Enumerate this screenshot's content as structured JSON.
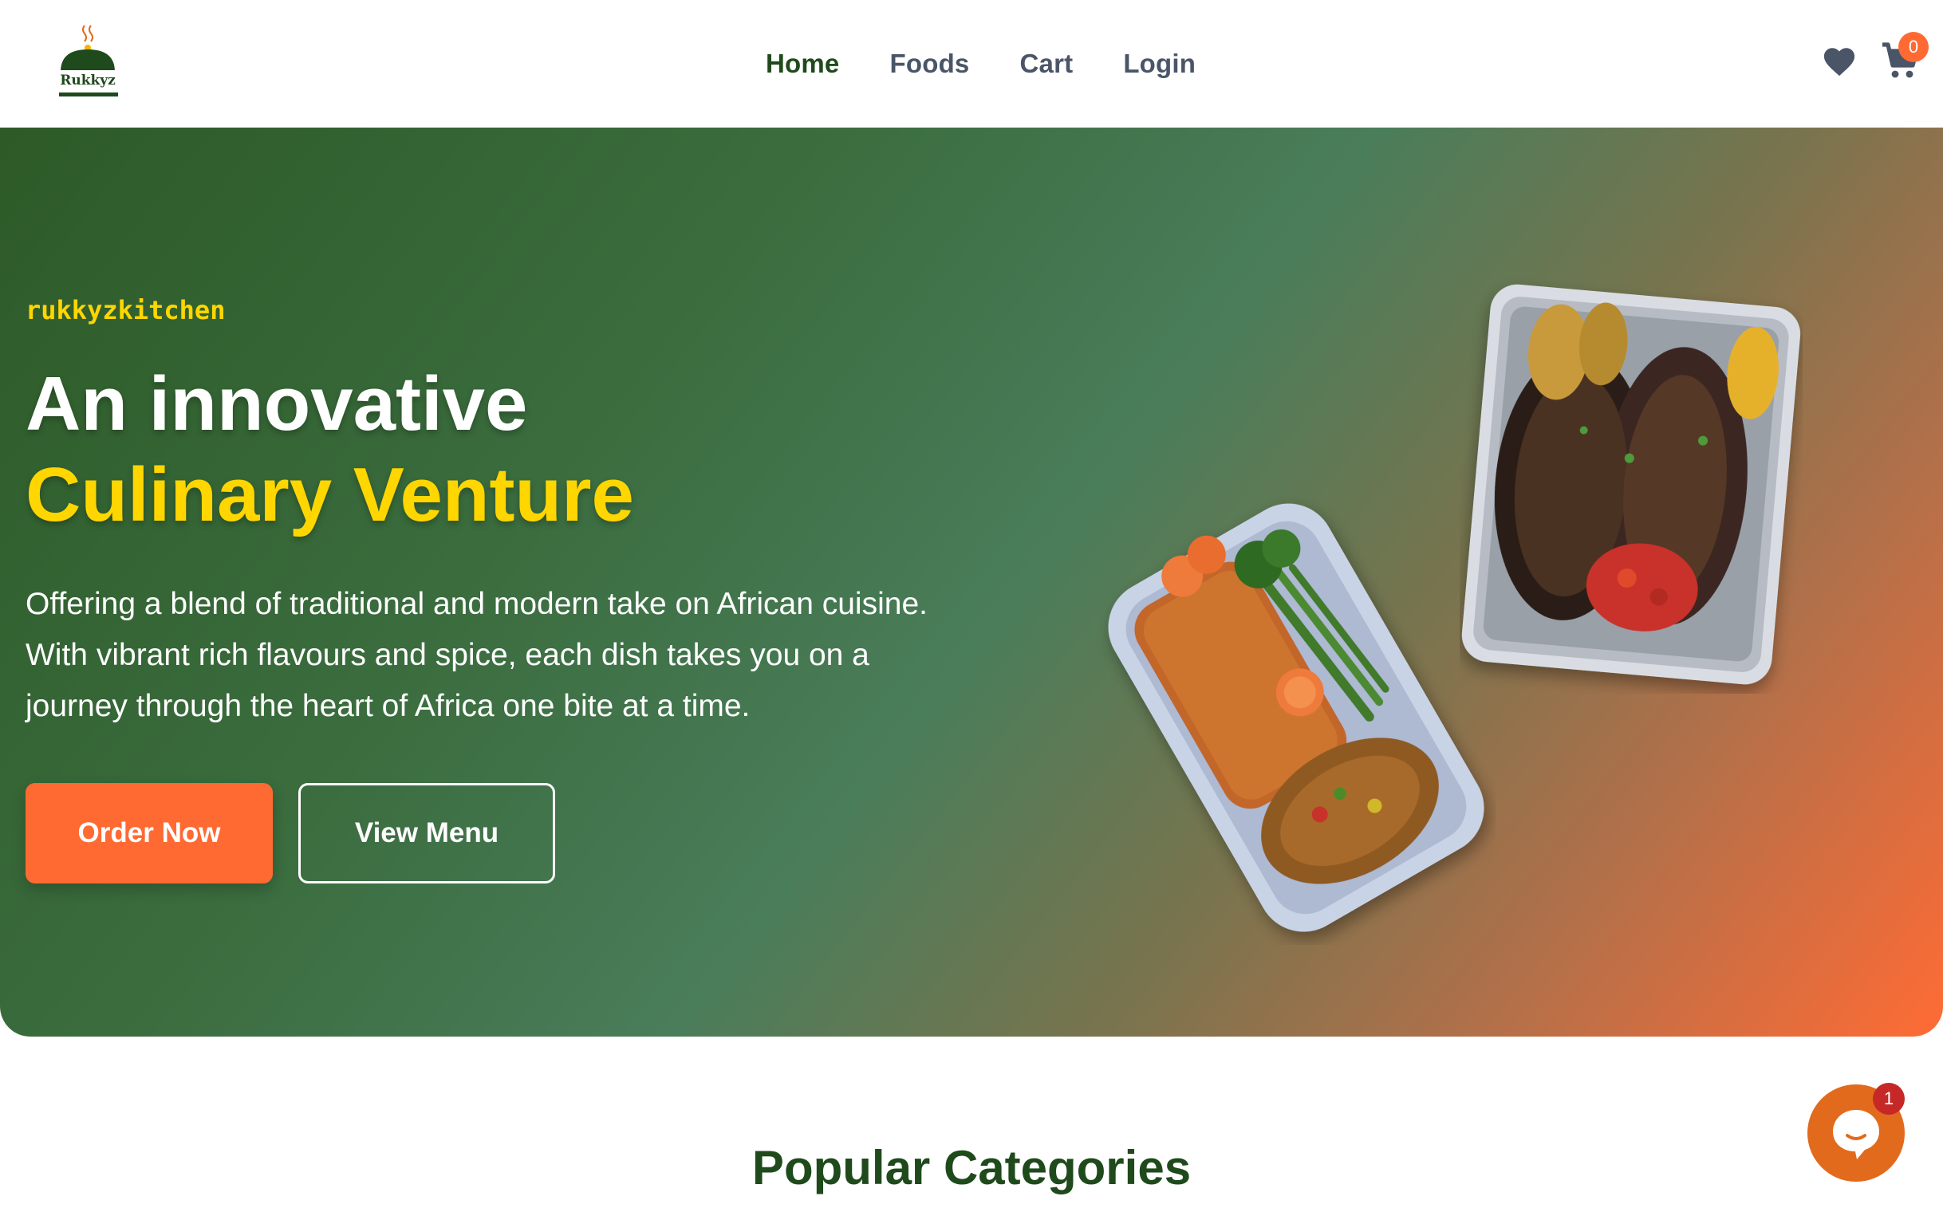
{
  "header": {
    "logo_text": "Rukkyz",
    "nav": [
      {
        "label": "Home",
        "active": true
      },
      {
        "label": "Foods",
        "active": false
      },
      {
        "label": "Cart",
        "active": false
      },
      {
        "label": "Login",
        "active": false
      }
    ],
    "wishlist_icon": "heart-icon",
    "cart_icon": "cart-icon",
    "cart_count": "0"
  },
  "hero": {
    "brand": "rukkyzkitchen",
    "headline_line1": "An innovative",
    "headline_line2": "Culinary Venture",
    "description": "Offering a blend of traditional and modern take on African cuisine. With vibrant rich flavours and spice, each dish takes you on a journey through the heart of Africa one bite at a time.",
    "order_button": "Order Now",
    "menu_button": "View Menu"
  },
  "section": {
    "title": "Popular Categories"
  },
  "chat": {
    "icon": "chat-icon",
    "badge": "1"
  },
  "colors": {
    "brand_green": "#1f4a1c",
    "accent_orange": "#ff6a33",
    "accent_yellow": "#ffd600"
  }
}
